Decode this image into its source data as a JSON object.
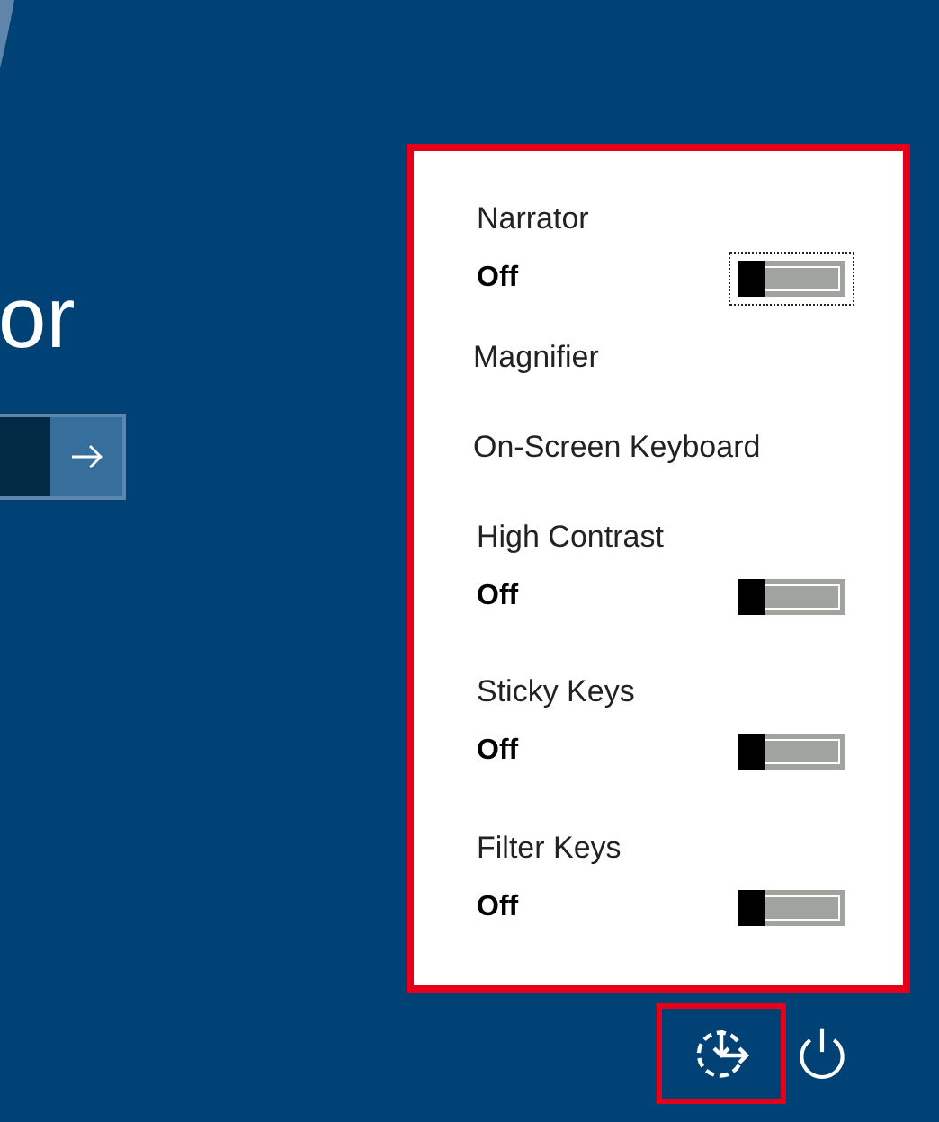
{
  "login": {
    "user_name": "or"
  },
  "ease_panel": {
    "highlighted": true,
    "items": [
      {
        "kind": "toggle",
        "label": "Narrator",
        "state": "Off",
        "on": false,
        "focused": true
      },
      {
        "kind": "link",
        "label": "Magnifier"
      },
      {
        "kind": "link",
        "label": "On-Screen Keyboard"
      },
      {
        "kind": "toggle",
        "label": "High Contrast",
        "state": "Off",
        "on": false,
        "focused": false
      },
      {
        "kind": "toggle",
        "label": "Sticky Keys",
        "state": "Off",
        "on": false,
        "focused": false
      },
      {
        "kind": "toggle",
        "label": "Filter Keys",
        "state": "Off",
        "on": false,
        "focused": false
      }
    ]
  },
  "bottom_buttons": [
    {
      "kind": "ease",
      "highlighted": true
    },
    {
      "kind": "power",
      "highlighted": false
    }
  ]
}
